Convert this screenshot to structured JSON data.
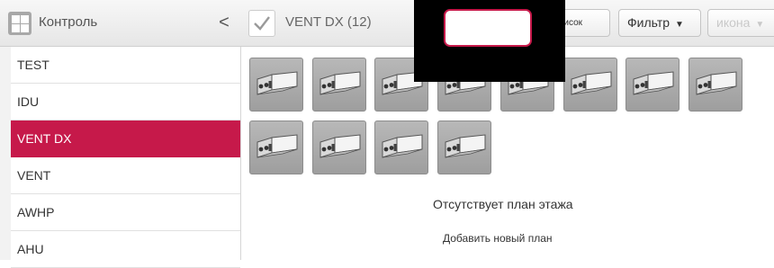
{
  "sidebar": {
    "title": "Контроль",
    "collapse_glyph": "<",
    "items": [
      {
        "label": "TEST",
        "active": false
      },
      {
        "label": "IDU",
        "active": false
      },
      {
        "label": "VENT DX",
        "active": true
      },
      {
        "label": "VENT",
        "active": false
      },
      {
        "label": "AWHP",
        "active": false
      },
      {
        "label": "AHU",
        "active": false
      }
    ]
  },
  "header": {
    "group_title": "VENT DX (12)",
    "list_button": "писок",
    "filter_button": "Фильтр",
    "icon_button": "икона"
  },
  "devices": {
    "count": 12,
    "icon": "ventilation-unit-icon"
  },
  "main": {
    "no_plan_text": "Отсутствует план этажа",
    "add_plan_text": "Добавить новый план"
  },
  "colors": {
    "accent": "#c6194a",
    "tile": "#a6a6a6",
    "redaction": "#000000"
  }
}
